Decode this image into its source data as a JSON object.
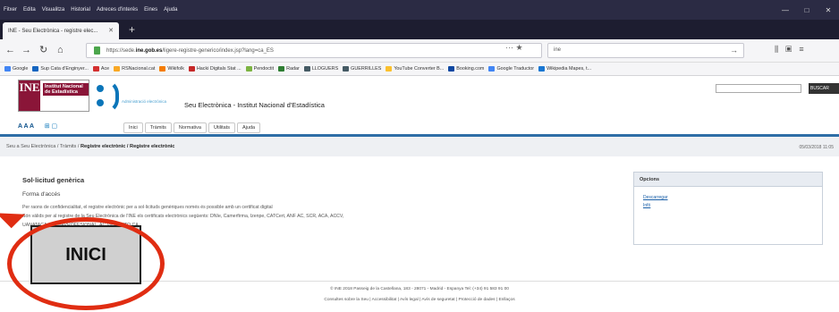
{
  "browser": {
    "menu": [
      "Fitxer",
      "Edita",
      "Visualitza",
      "Historial",
      "Adreces d'interès",
      "Eines",
      "Ajuda"
    ],
    "tab_title": "INE - Seu Electrònica - registre elec...",
    "url_prefix": "https://sede.",
    "url_domain": "ine.gob.es",
    "url_suffix": "/ligere-registre-generico/index.jsp?lang=ca_ES",
    "search_placeholder": "ine",
    "bookmarks": [
      {
        "label": "Google",
        "color": "#4285f4"
      },
      {
        "label": "Sup Cata d'Enginyer...",
        "color": "#1565c0"
      },
      {
        "label": "Ace",
        "color": "#d32f2f"
      },
      {
        "label": "RSNacional.cat",
        "color": "#f9a825"
      },
      {
        "label": "Wikifolk",
        "color": "#f57c00"
      },
      {
        "label": "Hacki Digitals Stat ...",
        "color": "#c62828"
      },
      {
        "label": "Pendoctit",
        "color": "#7cb342"
      },
      {
        "label": "Radar",
        "color": "#2e7d32"
      },
      {
        "label": "LLOGUERS",
        "color": "#455a64"
      },
      {
        "label": "GUERRILLES",
        "color": "#455a64"
      },
      {
        "label": "YouTube Converter B...",
        "color": "#fbc02d"
      },
      {
        "label": "Booking.com",
        "color": "#0d47a1"
      },
      {
        "label": "Google Traductor",
        "color": "#4285f4"
      },
      {
        "label": "Wikipedia Mapes, t...",
        "color": "#1976d2"
      }
    ]
  },
  "site": {
    "logo_ine": "INE",
    "logo_text": "Institut Nacional de Estadística",
    "admin_text": "Administració electrònica",
    "title": "Seu Electrònica - Institut Nacional d'Estadística",
    "search_button": "BUSCAR",
    "tools": "A A A",
    "nav": [
      "Inici",
      "Tràmits",
      "Normativa",
      "Utilitats",
      "Ajuda"
    ],
    "breadcrumb_plain": "Seu a Seu Electrònica / Tràmits / ",
    "breadcrumb_bold": "Registre electrònic / Registre electrònic",
    "date": "05/03/2018 11:05",
    "heading": "Sol·licitud genèrica",
    "subheading": "Forma d'accés",
    "para1": "Per raons de confidencialitat, el registre electrònic per a sol·licituds genèriques només és possible amb un certificat digital",
    "para2": "Són vàlids per al registre de la Seu Electrònica de l'INE els certificats electrònics següents: DNIe, Camerfirma, Izenpe, CATCert, ANF AC, SCR, ACA, ACCV,",
    "para3": "UANATACA, FIRMAPROFESIONAL, AC VERACITO CA",
    "options_title": "Opcions",
    "options_links": [
      "Descarregar",
      "Infó"
    ],
    "footer1": "© INE 2018   Passeig de la Castellana, 183 - 28071 - Madrid - Espanya  Tel: (+34) 91 583 91 00",
    "footer2": "Consultes sobre la Seu  |  Accessibilitat  |  Avís legal  |  Avís de seguretat  |  Protecció de dades  |  Enllaços",
    "inici_button": "INICI"
  }
}
